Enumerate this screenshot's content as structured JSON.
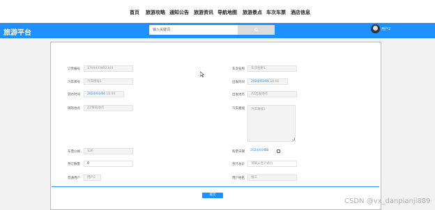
{
  "nav": {
    "items": [
      "首页",
      "旅游攻略",
      "通知公告",
      "旅游资讯",
      "导航地图",
      "旅游景点",
      "车次车票",
      "酒店信息"
    ]
  },
  "header": {
    "brand": "旅游平台",
    "search_placeholder": "输入关键词",
    "username": "用户2"
  },
  "form": {
    "order_no_label": "订单编号",
    "order_no_value": "1709433852300",
    "car_no_label": "汽车牌号",
    "car_no_value": "汽车牌号1",
    "arrive_time_label": "到达时间",
    "arrive_date": "2024/03/",
    "arrive_day": "04",
    "arrive_time": "18:00",
    "dest_label": "目的地点",
    "dest_value": "ZZ目的地点",
    "trip_name_label": "车次名称",
    "trip_name_value": "车次名称1",
    "depart_time_label": "出发时间",
    "depart_date": "2024/03/",
    "depart_day": "06",
    "depart_time": "10:00",
    "depart_place_label": "出发地点",
    "depart_place_value": "ZZ出发地点",
    "route_label": "汽车路线",
    "route_value": "汽车路线1",
    "price_label": "车票价格",
    "price_value": "126",
    "booking_date_label": "购票日期",
    "booking_date": "2024/03/",
    "booking_day": "03",
    "qty_label": "预订数量",
    "qty_value": "0",
    "total_label": "合计总价",
    "total_placeholder": "请输入合计总价",
    "account_label": "普通用户",
    "account_value": "用户2",
    "user_name_label": "用户姓名",
    "user_name_value": "张三",
    "submit_label": "提交"
  },
  "watermark": "CSDN @vx_danpianji889",
  "colors": {
    "accent": "#1e90ff"
  }
}
